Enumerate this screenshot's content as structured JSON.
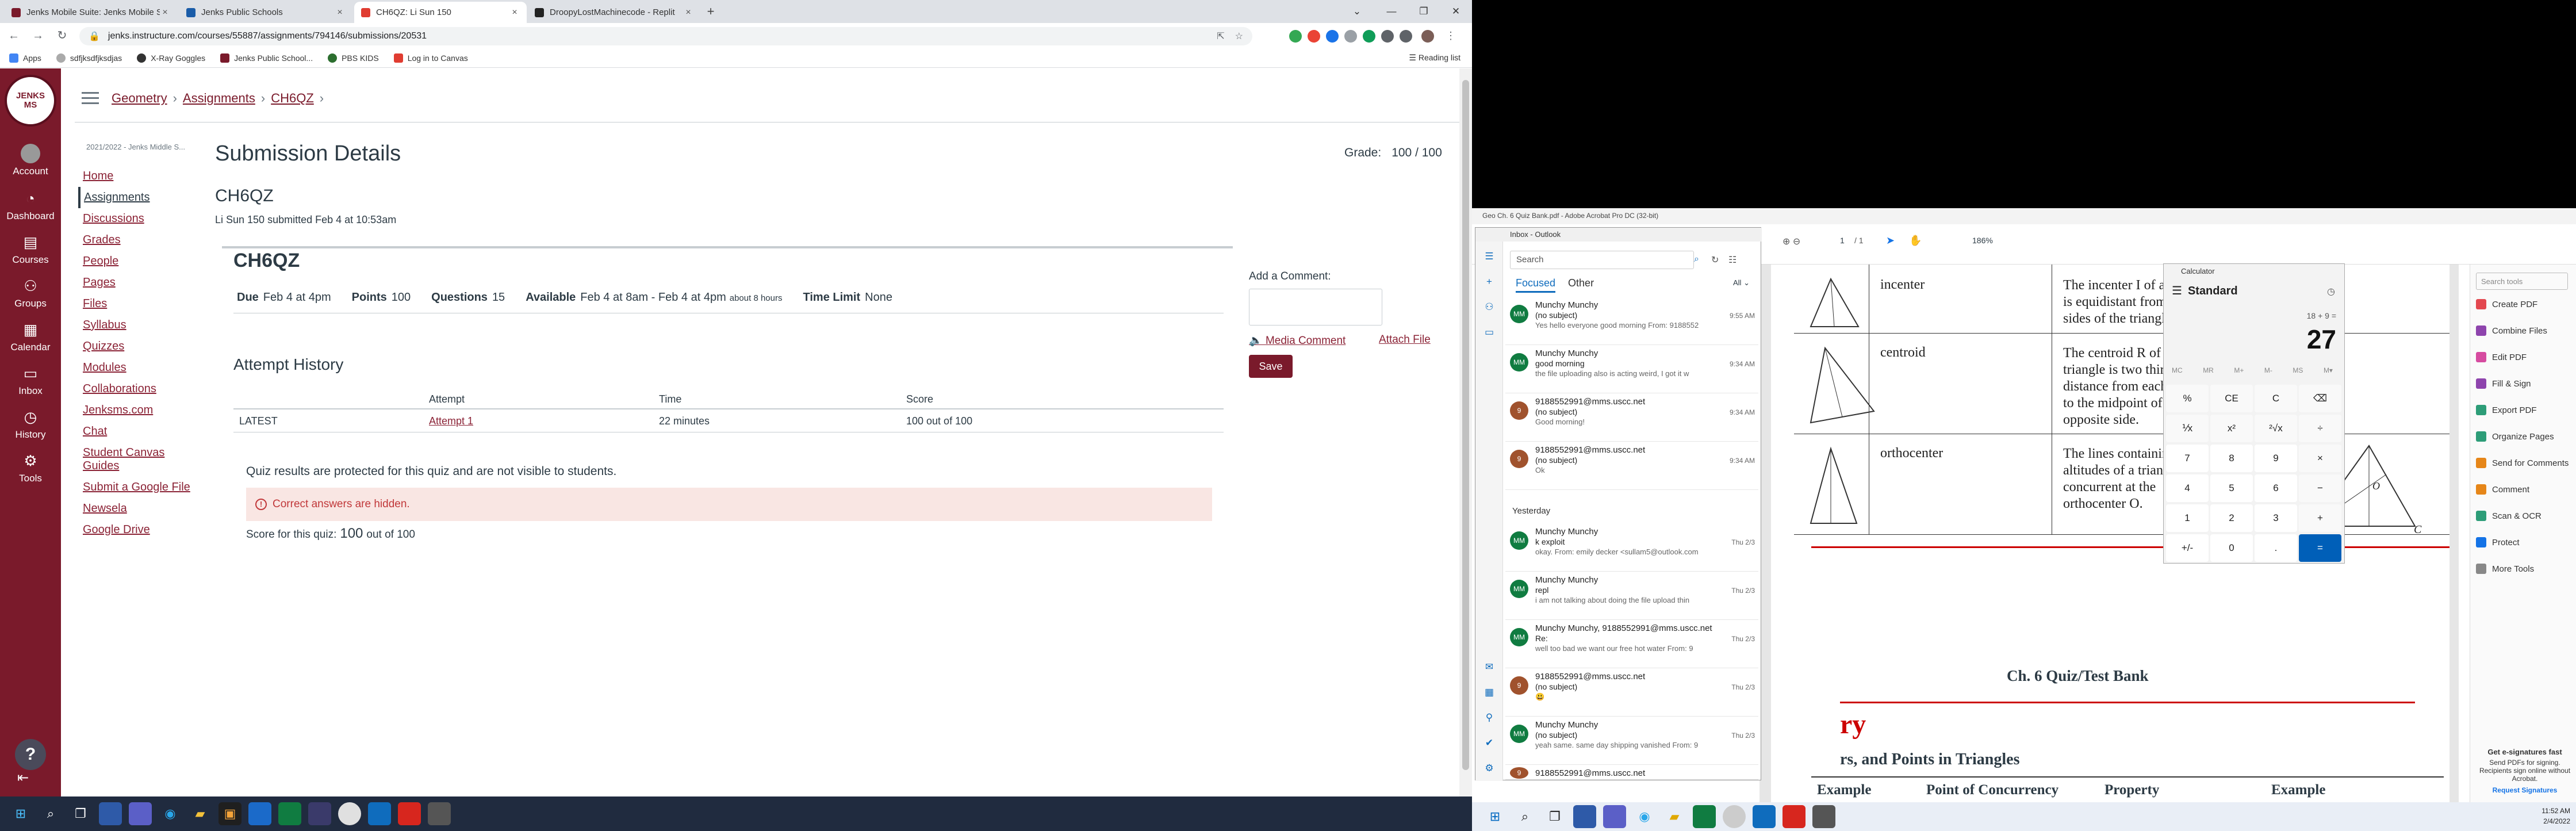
{
  "browser": {
    "tabs": [
      {
        "title": "Jenks Mobile Suite: Jenks Mobile S...",
        "active": false,
        "fav_color": "#7a1a2b"
      },
      {
        "title": "Jenks Public Schools",
        "active": false,
        "fav_color": "#1a5ca8"
      },
      {
        "title": "CH6QZ: Li Sun 150",
        "active": true,
        "fav_color": "#e03c31"
      },
      {
        "title": "DroopyLostMachinecode - Replit",
        "active": false,
        "fav_color": "#222"
      }
    ],
    "url": "jenks.instructure.com/courses/55887/assignments/794146/submissions/20531",
    "bookmarks": [
      "Apps",
      "sdfjksdfjksdjas",
      "X-Ray Goggles",
      "Jenks Public School...",
      "PBS KIDS",
      "Log in to Canvas"
    ],
    "reading_list": "Reading list"
  },
  "global_nav": {
    "items": [
      {
        "label": "Account",
        "icon": "account-icon"
      },
      {
        "label": "Dashboard",
        "icon": "dashboard-icon"
      },
      {
        "label": "Courses",
        "icon": "courses-icon"
      },
      {
        "label": "Groups",
        "icon": "groups-icon"
      },
      {
        "label": "Calendar",
        "icon": "calendar-icon"
      },
      {
        "label": "Inbox",
        "icon": "inbox-icon"
      },
      {
        "label": "History",
        "icon": "history-icon"
      },
      {
        "label": "Tools",
        "icon": "tools-icon"
      }
    ],
    "brand_color": "#7a1a2b"
  },
  "breadcrumbs": [
    "Geometry",
    "Assignments",
    "CH6QZ"
  ],
  "term": "2021/2022 - Jenks Middle S...",
  "course_nav": [
    "Home",
    "Assignments",
    "Discussions",
    "Grades",
    "People",
    "Pages",
    "Files",
    "Syllabus",
    "Quizzes",
    "Modules",
    "Collaborations",
    "Jenksms.com",
    "Chat",
    "Student Canvas Guides",
    "Submit a Google File",
    "Newsela",
    "Google Drive"
  ],
  "course_nav_active": "Assignments",
  "page": {
    "title": "Submission Details",
    "grade_label": "Grade:",
    "grade_value": "100 / 100",
    "quiz_name": "CH6QZ",
    "submitted": "Li Sun 150 submitted Feb 4 at 10:53am"
  },
  "quiz": {
    "title": "CH6QZ",
    "due_label": "Due",
    "due": "Feb 4 at 4pm",
    "points_label": "Points",
    "points": "100",
    "questions_label": "Questions",
    "questions": "15",
    "available_label": "Available",
    "available": "Feb 4 at 8am - Feb 4 at 4pm",
    "available_note": "about 8 hours",
    "time_limit_label": "Time Limit",
    "time_limit": "None",
    "history_title": "Attempt History",
    "columns": [
      "Attempt",
      "Time",
      "Score"
    ],
    "rows": [
      {
        "tag": "LATEST",
        "attempt": "Attempt 1",
        "time": "22 minutes",
        "score": "100 out of 100"
      }
    ],
    "protected_msg": "Quiz results are protected for this quiz and are not visible to students.",
    "alert": "Correct answers are hidden.",
    "score_prefix": "Score for this quiz:",
    "score_value": "100",
    "score_suffix": "out of 100"
  },
  "comment": {
    "label": "Add a Comment:",
    "media": "Media Comment",
    "attach": "Attach File",
    "save": "Save"
  },
  "acrobat": {
    "title": "Geo Ch. 6 Quiz Bank.pdf - Adobe Acrobat Pro DC (32-bit)",
    "page_field": "1",
    "page_total": "/ 1",
    "zoom": "186%",
    "rows": [
      {
        "name": "incenter",
        "desc": "The incenter I of a triangle is equidistant from the sides of the triangle."
      },
      {
        "name": "centroid",
        "desc": "The centroid R of a triangle is two thirds of the distance from each vertex to the midpoint of the opposite side."
      },
      {
        "name": "orthocenter",
        "desc": "The lines containing the altitudes of a triangle are concurrent at the orthocenter O."
      }
    ],
    "heading": "Ch. 6 Quiz/Test Bank",
    "red_text": "ry",
    "section": "rs, and Points in Triangles",
    "table_headers": [
      "Example",
      "Point of Concurrency",
      "Property",
      "Example"
    ],
    "tools_search": "Search tools",
    "tools": [
      "Create PDF",
      "Combine Files",
      "Edit PDF",
      "Fill & Sign",
      "Export PDF",
      "Organize Pages",
      "Send for Comments",
      "Comment",
      "Scan & OCR",
      "Protect",
      "More Tools"
    ],
    "esig_title": "Get e-signatures fast",
    "esig_body": "Send PDFs for signing. Recipients sign online without Acrobat.",
    "esig_link": "Request Signatures",
    "labels": {
      "A": "A",
      "C": "C",
      "O": "O"
    }
  },
  "outlook": {
    "title": "Inbox - Outlook",
    "search": "Search",
    "focused": "Focused",
    "other": "Other",
    "all": "All",
    "yesterday": "Yesterday",
    "messages": [
      {
        "from": "Munchy Munchy",
        "subject": "(no subject)",
        "preview": "Yes hello everyone good morning From: 9188552",
        "time": "9:55 AM",
        "color": "#107c41",
        "initials": "MM"
      },
      {
        "from": "Munchy Munchy",
        "subject": "good morning",
        "preview": "the file uploading also is acting weird, I got it w",
        "time": "9:34 AM",
        "color": "#107c41",
        "initials": "MM"
      },
      {
        "from": "9188552991@mms.uscc.net",
        "subject": "(no subject)",
        "preview": "Good morning!",
        "time": "9:34 AM",
        "color": "#a0522d",
        "initials": "9"
      },
      {
        "from": "9188552991@mms.uscc.net",
        "subject": "(no subject)",
        "preview": "Ok",
        "time": "9:34 AM",
        "color": "#a0522d",
        "initials": "9"
      },
      {
        "from": "Munchy Munchy",
        "subject": "k exploit",
        "preview": "okay. From: emily decker <sullam5@outlook.com",
        "time": "Thu 2/3",
        "color": "#107c41",
        "initials": "MM"
      },
      {
        "from": "Munchy Munchy",
        "subject": "repl",
        "preview": "i am not talking about doing the file upload thin",
        "time": "Thu 2/3",
        "color": "#107c41",
        "initials": "MM"
      },
      {
        "from": "Munchy Munchy, 9188552991@mms.uscc.net",
        "subject": "Re:",
        "preview": "well too bad we want our free hot water From: 9",
        "time": "Thu 2/3",
        "color": "#107c41",
        "initials": "MM"
      },
      {
        "from": "9188552991@mms.uscc.net",
        "subject": "(no subject)",
        "preview": "😃",
        "time": "Thu 2/3",
        "color": "#a0522d",
        "initials": "9"
      },
      {
        "from": "Munchy Munchy",
        "subject": "(no subject)",
        "preview": "yeah same. same day shipping vanished From: 9",
        "time": "Thu 2/3",
        "color": "#107c41",
        "initials": "MM"
      },
      {
        "from": "9188552991@mms.uscc.net",
        "subject": "",
        "preview": "",
        "time": "",
        "color": "#a0522d",
        "initials": "9"
      }
    ]
  },
  "calculator": {
    "title": "Calculator",
    "mode": "Standard",
    "expression": "18 + 9 =",
    "result": "27",
    "memory": [
      "MC",
      "MR",
      "M+",
      "M-",
      "MS",
      "M▾"
    ],
    "keys": [
      "%",
      "CE",
      "C",
      "⌫",
      "⅟x",
      "x²",
      "²√x",
      "÷",
      "7",
      "8",
      "9",
      "×",
      "4",
      "5",
      "6",
      "−",
      "1",
      "2",
      "3",
      "+",
      "+/-",
      "0",
      ".",
      "="
    ]
  },
  "clock": {
    "time": "11:52 AM",
    "date": "2/4/2022"
  }
}
